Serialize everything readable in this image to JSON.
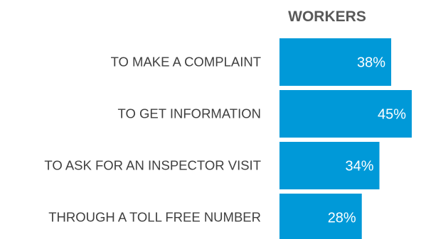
{
  "chart_data": {
    "type": "bar",
    "orientation": "horizontal",
    "title": "",
    "xlabel": "",
    "ylabel": "",
    "categories": [
      "TO MAKE A COMPLAINT",
      "TO GET INFORMATION",
      "TO ASK FOR AN INSPECTOR VISIT",
      "THROUGH A TOLL FREE NUMBER"
    ],
    "series": [
      {
        "name": "WORKERS",
        "values": [
          38,
          45,
          34,
          28
        ],
        "labels": [
          "38%",
          "45%",
          "34%",
          "28%"
        ],
        "color": "#0099d8"
      }
    ],
    "xlim": [
      0,
      45
    ],
    "grid": false,
    "legend": "none"
  }
}
